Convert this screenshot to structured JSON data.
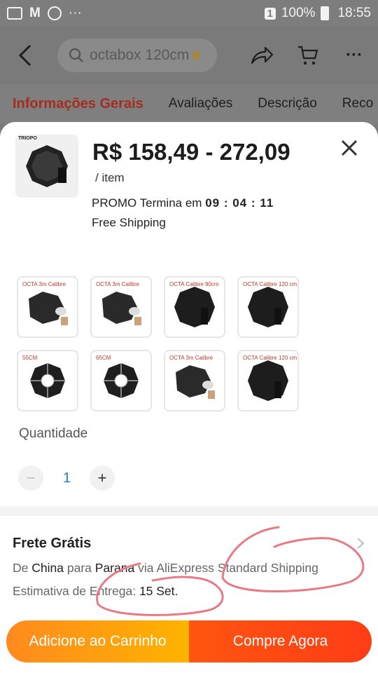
{
  "status_bar": {
    "battery_text": "100%",
    "time": "18:55",
    "sim_badge": "1"
  },
  "nav": {
    "search_text": "octabox 120cm"
  },
  "tabs": {
    "items": [
      "Informações Gerais",
      "Avaliações",
      "Descrição",
      "Reco"
    ]
  },
  "product": {
    "thumb_brand": "TRIOPO",
    "price": "R$ 158,49 - 272,09",
    "unit": "/ item",
    "promo_label": "PROMO Termina em",
    "promo_timer": "09 : 04 : 11",
    "free_shipping": "Free Shipping"
  },
  "variants": [
    {
      "tag": "OCTA 3m Calibre",
      "style": "light"
    },
    {
      "tag": "OCTA 3m Calibre",
      "style": "light"
    },
    {
      "tag": "OCTA Calibre 90cm",
      "style": "dark"
    },
    {
      "tag": "OCTA Calibre 120 cm",
      "style": "dark"
    },
    {
      "tag": "55CM",
      "style": "top"
    },
    {
      "tag": "65CM",
      "style": "top"
    },
    {
      "tag": "OCTA 3m Calibre",
      "style": "light"
    },
    {
      "tag": "OCTA Calibre 120 cm",
      "style": "dark"
    }
  ],
  "quantity": {
    "label": "Quantidade",
    "minus": "−",
    "value": "1",
    "plus": "+"
  },
  "shipping": {
    "title": "Frete Grátis",
    "from_label": "De",
    "from": "China",
    "to_label": "para",
    "to": "Parana",
    "via_label": "via",
    "carrier": "AliExpress Standard Shipping",
    "estimate_label": "Estimativa de Entrega:",
    "estimate": "15 Set."
  },
  "actions": {
    "add_to_cart": "Adicione ao Carrinho",
    "buy_now": "Compre Agora"
  },
  "colors": {
    "accent_red": "#ff3d16",
    "accent_orange": "#ff8a1f",
    "tab_active": "#a62d1e",
    "scribble": "#e87a86"
  }
}
